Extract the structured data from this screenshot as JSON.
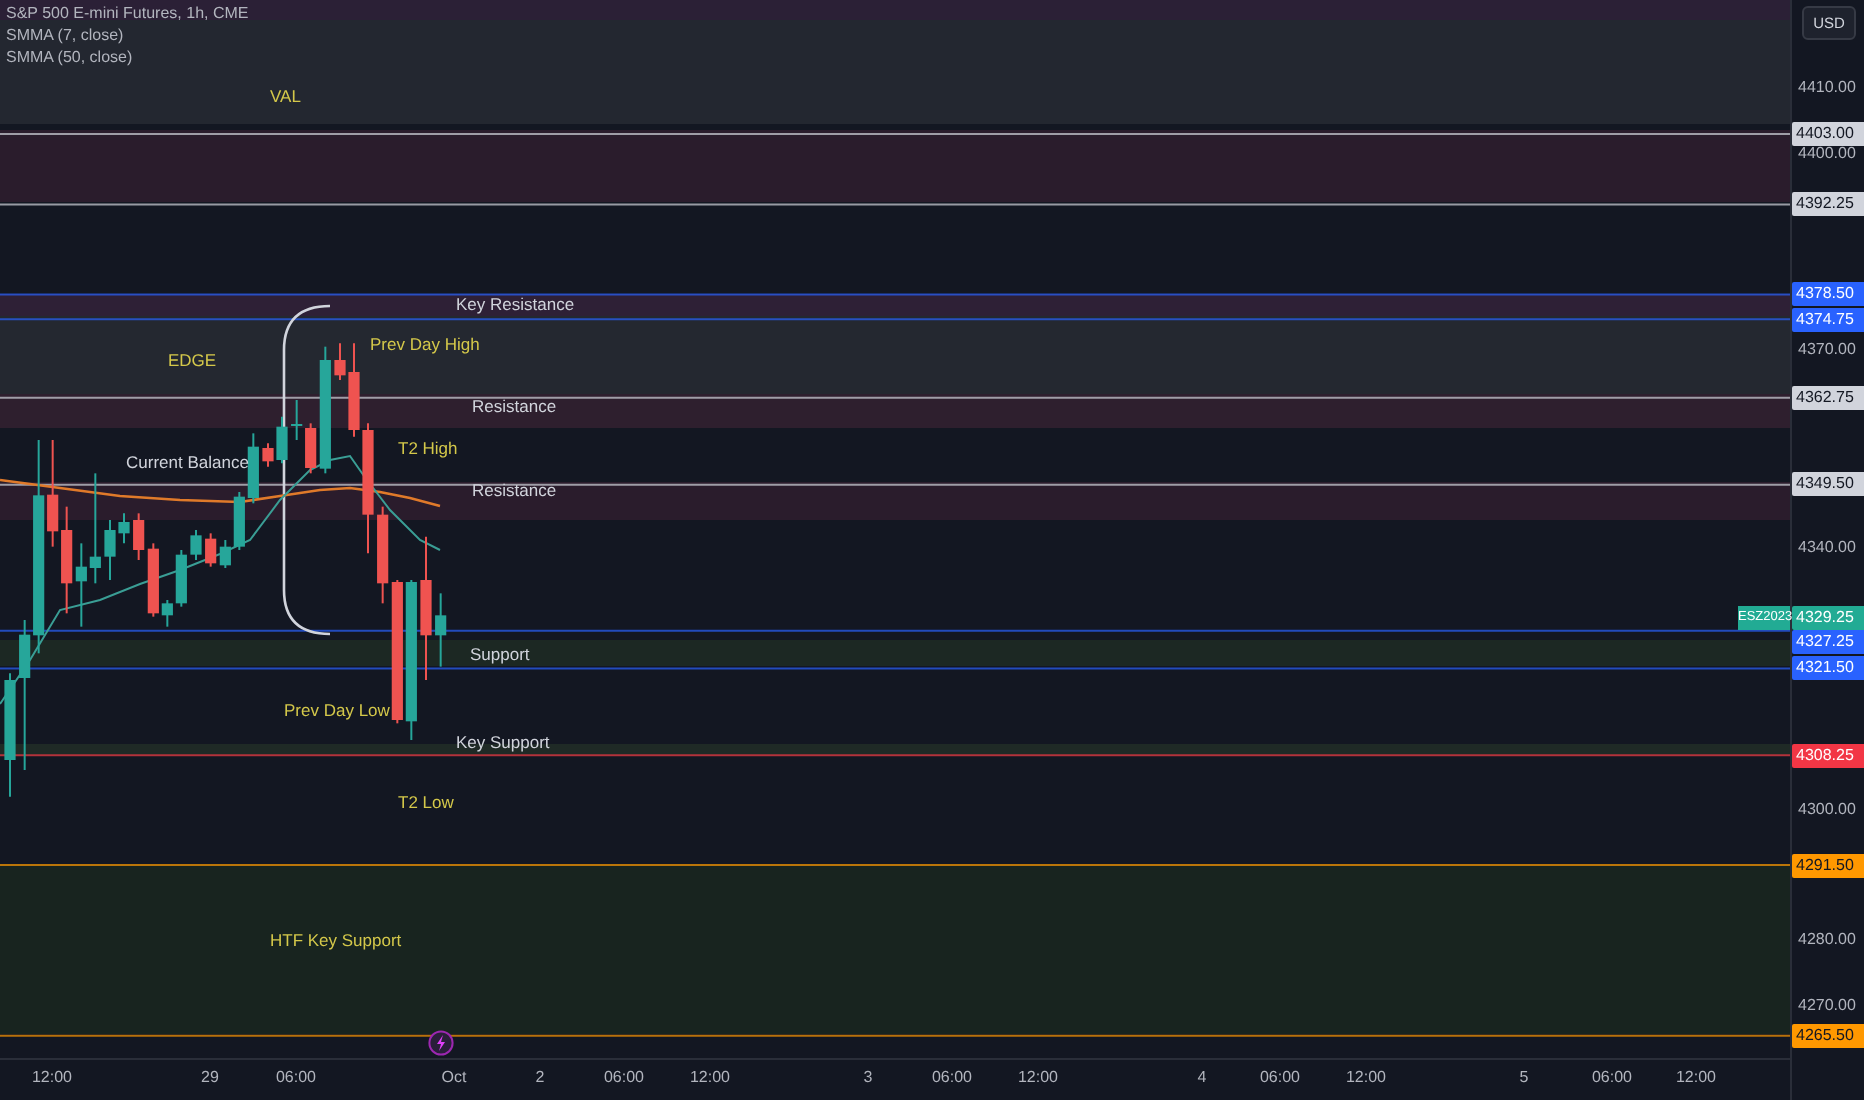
{
  "legend": {
    "symbol": "S&P 500 E-mini Futures, 1h, CME",
    "indicators": [
      "SMMA (7, close)",
      "SMMA (50, close)"
    ]
  },
  "currency_button": "USD",
  "chart_labels": [
    {
      "text": "VAL",
      "color": "#d4c84a"
    },
    {
      "text": "Key Resistance",
      "color": "#d1d4dc"
    },
    {
      "text": "EDGE",
      "color": "#d4c84a"
    },
    {
      "text": "Prev Day High",
      "color": "#d4c84a"
    },
    {
      "text": "Resistance",
      "color": "#d1d4dc"
    },
    {
      "text": "T2 High",
      "color": "#d4c84a"
    },
    {
      "text": "Current Balance",
      "color": "#d1d4dc"
    },
    {
      "text": "Resistance",
      "color": "#d1d4dc"
    },
    {
      "text": "Support",
      "color": "#d1d4dc"
    },
    {
      "text": "Prev Day Low",
      "color": "#d4c84a"
    },
    {
      "text": "Key Support",
      "color": "#d1d4dc"
    },
    {
      "text": "T2 Low",
      "color": "#d4c84a"
    },
    {
      "text": "HTF Key Support",
      "color": "#d4c84a"
    }
  ],
  "price_ticks": [
    "4410.00",
    "4400.00",
    "4370.00",
    "4340.00",
    "4300.00",
    "4280.00",
    "4270.00"
  ],
  "price_tags": [
    {
      "text": "4403.00",
      "color": "#d1d4dc"
    },
    {
      "text": "4392.25",
      "color": "#d1d4dc"
    },
    {
      "text": "4378.50",
      "color": "#2962ff"
    },
    {
      "text": "4374.75",
      "color": "#2962ff"
    },
    {
      "text": "4362.75",
      "color": "#d1d4dc"
    },
    {
      "text": "4349.50",
      "color": "#d1d4dc"
    },
    {
      "text": "4329.25",
      "color": "#22ab94",
      "symbol": "ESZ2023"
    },
    {
      "text": "4327.25",
      "color": "#2962ff"
    },
    {
      "text": "4321.50",
      "color": "#2962ff"
    },
    {
      "text": "4308.25",
      "color": "#f23645"
    },
    {
      "text": "4291.50",
      "color": "#ff9800"
    },
    {
      "text": "4265.50",
      "color": "#ff9800"
    }
  ],
  "time_axis": [
    "12:00",
    "29",
    "06:00",
    "Oct",
    "2",
    "06:00",
    "12:00",
    "3",
    "06:00",
    "12:00",
    "4",
    "06:00",
    "12:00",
    "5",
    "06:00",
    "12:00"
  ]
}
